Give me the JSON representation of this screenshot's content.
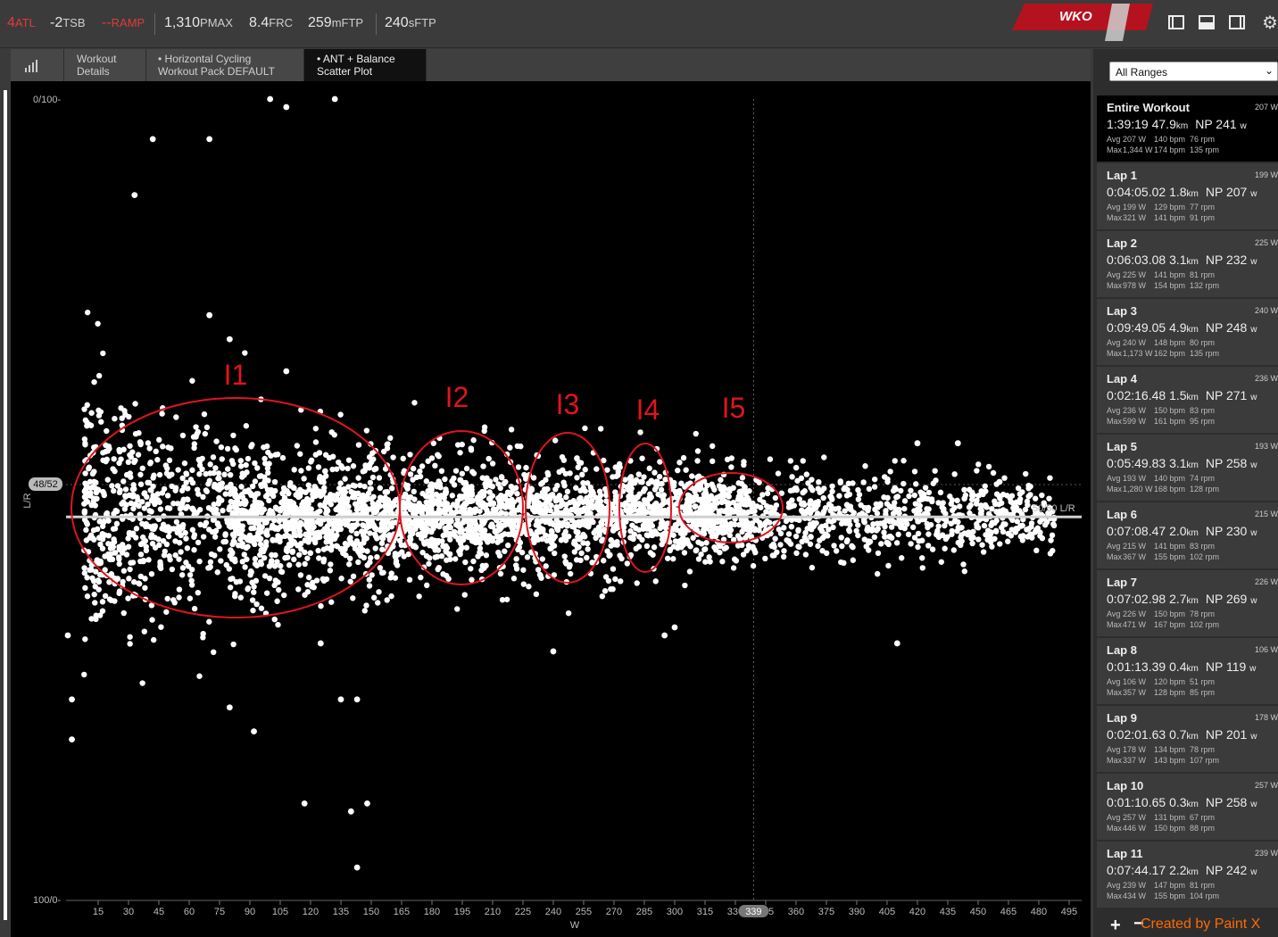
{
  "metrics": {
    "atl": {
      "value": "4",
      "unit": "ATL"
    },
    "tsb": {
      "value": "-2",
      "unit": "TSB"
    },
    "ramp": {
      "value": "--",
      "unit": "RAMP"
    },
    "pmax": {
      "value": "1,310",
      "unit": "PMAX"
    },
    "frc": {
      "value": "8.4",
      "unit": "FRC"
    },
    "mftp": {
      "value": "259",
      "unit": "mFTP"
    },
    "sftp": {
      "value": "240",
      "unit": "sFTP"
    }
  },
  "brand": {
    "logo_text": "WKO",
    "logo_number": "4",
    "accent": "#c8102e"
  },
  "tabs": [
    {
      "line1": "",
      "line2": "",
      "icon": "bar-chart-icon"
    },
    {
      "line1": "Workout",
      "line2": "Details"
    },
    {
      "line1": "• Horizontal Cycling",
      "line2": "Workout Pack DEFAULT"
    },
    {
      "line1": "• ANT + Balance",
      "line2": "Scatter Plot"
    }
  ],
  "chart_data": {
    "type": "scatter",
    "xlabel": "W",
    "ylabel": "L/R",
    "x_ticks": [
      15,
      30,
      45,
      60,
      75,
      90,
      105,
      120,
      135,
      150,
      165,
      180,
      195,
      210,
      225,
      240,
      255,
      270,
      285,
      300,
      315,
      330,
      345,
      360,
      375,
      390,
      405,
      420,
      435,
      450,
      465,
      480,
      495
    ],
    "y_tick_top": "0/100-",
    "y_tick_bottom": "100/0-",
    "y_marker_label": "48/52",
    "balance_line_label": "50/50 L/R",
    "x_cursor_label": "339",
    "xlim": [
      0,
      500
    ],
    "annotations": [
      {
        "label": "I1",
        "x_center": 65,
        "balance_center": 48
      },
      {
        "label": "I2",
        "x_center": 195,
        "balance_center": 48
      },
      {
        "label": "I3",
        "x_center": 250,
        "balance_center": 48
      },
      {
        "label": "I4",
        "x_center": 285,
        "balance_center": 48
      },
      {
        "label": "I5",
        "x_center": 330,
        "balance_center": 48
      }
    ],
    "annotation_color": "#e0141e",
    "point_color": "#ffffff",
    "outliers": [
      {
        "x": 100,
        "y": 0
      },
      {
        "x": 108,
        "y": 1
      },
      {
        "x": 132,
        "y": 0
      },
      {
        "x": 42,
        "y": 5
      },
      {
        "x": 70,
        "y": 5
      },
      {
        "x": 33,
        "y": 12
      },
      {
        "x": 70,
        "y": 27
      },
      {
        "x": 80,
        "y": 30
      },
      {
        "x": 108,
        "y": 34
      },
      {
        "x": 0,
        "y": 67
      },
      {
        "x": 2,
        "y": 75
      },
      {
        "x": 2,
        "y": 80
      },
      {
        "x": 80,
        "y": 76
      },
      {
        "x": 92,
        "y": 79
      },
      {
        "x": 117,
        "y": 88
      },
      {
        "x": 140,
        "y": 89
      },
      {
        "x": 148,
        "y": 88
      },
      {
        "x": 143,
        "y": 96
      },
      {
        "x": 125,
        "y": 68
      },
      {
        "x": 135,
        "y": 75
      },
      {
        "x": 143,
        "y": 75
      },
      {
        "x": 240,
        "y": 69
      },
      {
        "x": 410,
        "y": 68
      },
      {
        "x": 300,
        "y": 66
      },
      {
        "x": 295,
        "y": 67
      },
      {
        "x": 420,
        "y": 43
      },
      {
        "x": 440,
        "y": 43
      }
    ]
  },
  "sidebar": {
    "range_select": "All Ranges",
    "laps": [
      {
        "name": "Entire Workout",
        "avg_w": "207 W",
        "time": "1:39:19",
        "dist": "47.9",
        "dist_unit": "km",
        "np": "NP 241",
        "np_unit": "w",
        "avg": [
          "Avg",
          "207 W",
          "140 bpm",
          "76 rpm"
        ],
        "max": [
          "Max",
          "1,344 W",
          "174 bpm",
          "135 rpm"
        ]
      },
      {
        "name": "Lap 1",
        "avg_w": "199 W",
        "time": "0:04:05.02",
        "dist": "1.8",
        "dist_unit": "km",
        "np": "NP 207",
        "np_unit": "w",
        "avg": [
          "Avg",
          "199 W",
          "129 bpm",
          "77 rpm"
        ],
        "max": [
          "Max",
          "321 W",
          "141 bpm",
          "91 rpm"
        ]
      },
      {
        "name": "Lap 2",
        "avg_w": "225 W",
        "time": "0:06:03.08",
        "dist": "3.1",
        "dist_unit": "km",
        "np": "NP 232",
        "np_unit": "w",
        "avg": [
          "Avg",
          "225 W",
          "141 bpm",
          "81 rpm"
        ],
        "max": [
          "Max",
          "978 W",
          "154 bpm",
          "132 rpm"
        ]
      },
      {
        "name": "Lap 3",
        "avg_w": "240 W",
        "time": "0:09:49.05",
        "dist": "4.9",
        "dist_unit": "km",
        "np": "NP 248",
        "np_unit": "w",
        "avg": [
          "Avg",
          "240 W",
          "148 bpm",
          "80 rpm"
        ],
        "max": [
          "Max",
          "1,173 W",
          "162 bpm",
          "135 rpm"
        ]
      },
      {
        "name": "Lap 4",
        "avg_w": "236 W",
        "time": "0:02:16.48",
        "dist": "1.5",
        "dist_unit": "km",
        "np": "NP 271",
        "np_unit": "w",
        "avg": [
          "Avg",
          "236 W",
          "150 bpm",
          "83 rpm"
        ],
        "max": [
          "Max",
          "599 W",
          "161 bpm",
          "95 rpm"
        ]
      },
      {
        "name": "Lap 5",
        "avg_w": "193 W",
        "time": "0:05:49.83",
        "dist": "3.1",
        "dist_unit": "km",
        "np": "NP 258",
        "np_unit": "w",
        "avg": [
          "Avg",
          "193 W",
          "140 bpm",
          "74 rpm"
        ],
        "max": [
          "Max",
          "1,280 W",
          "168 bpm",
          "128 rpm"
        ]
      },
      {
        "name": "Lap 6",
        "avg_w": "215 W",
        "time": "0:07:08.47",
        "dist": "2.0",
        "dist_unit": "km",
        "np": "NP 230",
        "np_unit": "w",
        "avg": [
          "Avg",
          "215 W",
          "141 bpm",
          "83 rpm"
        ],
        "max": [
          "Max",
          "367 W",
          "155 bpm",
          "102 rpm"
        ]
      },
      {
        "name": "Lap 7",
        "avg_w": "226 W",
        "time": "0:07:02.98",
        "dist": "2.7",
        "dist_unit": "km",
        "np": "NP 269",
        "np_unit": "w",
        "avg": [
          "Avg",
          "226 W",
          "150 bpm",
          "78 rpm"
        ],
        "max": [
          "Max",
          "471 W",
          "167 bpm",
          "102 rpm"
        ]
      },
      {
        "name": "Lap 8",
        "avg_w": "106 W",
        "time": "0:01:13.39",
        "dist": "0.4",
        "dist_unit": "km",
        "np": "NP 119",
        "np_unit": "w",
        "avg": [
          "Avg",
          "106 W",
          "120 bpm",
          "51 rpm"
        ],
        "max": [
          "Max",
          "357 W",
          "128 bpm",
          "85 rpm"
        ]
      },
      {
        "name": "Lap 9",
        "avg_w": "178 W",
        "time": "0:02:01.63",
        "dist": "0.7",
        "dist_unit": "km",
        "np": "NP 201",
        "np_unit": "w",
        "avg": [
          "Avg",
          "178 W",
          "134 bpm",
          "78 rpm"
        ],
        "max": [
          "Max",
          "337 W",
          "143 bpm",
          "107 rpm"
        ]
      },
      {
        "name": "Lap 10",
        "avg_w": "257 W",
        "time": "0:01:10.65",
        "dist": "0.3",
        "dist_unit": "km",
        "np": "NP 258",
        "np_unit": "w",
        "avg": [
          "Avg",
          "257 W",
          "131 bpm",
          "67 rpm"
        ],
        "max": [
          "Max",
          "446 W",
          "150 bpm",
          "88 rpm"
        ]
      },
      {
        "name": "Lap 11",
        "avg_w": "239 W",
        "time": "0:07:44.17",
        "dist": "2.2",
        "dist_unit": "km",
        "np": "NP 242",
        "np_unit": "w",
        "avg": [
          "Avg",
          "239 W",
          "147 bpm",
          "81 rpm"
        ],
        "max": [
          "Max",
          "434 W",
          "155 bpm",
          "104 rpm"
        ]
      }
    ],
    "add_label": "+",
    "remove_label": "−"
  },
  "watermark": "Created by Paint X"
}
